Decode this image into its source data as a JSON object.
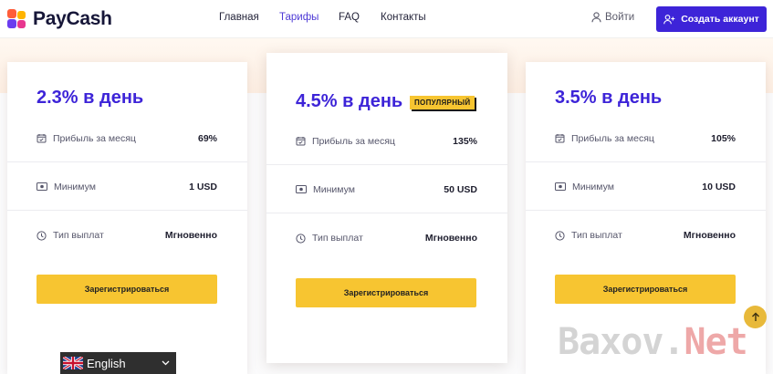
{
  "brand": {
    "name": "PayCash"
  },
  "nav": {
    "items": [
      {
        "label": "Главная",
        "active": false
      },
      {
        "label": "Тарифы",
        "active": true
      },
      {
        "label": "FAQ",
        "active": false
      },
      {
        "label": "Контакты",
        "active": false
      }
    ]
  },
  "header": {
    "login_label": "Войти",
    "signup_label": "Создать аккаунт"
  },
  "plans": [
    {
      "price": "2.3% в день",
      "badge": "",
      "rows": [
        {
          "icon": "calendar-check-icon",
          "label": "Прибыль за месяц",
          "value": "69%"
        },
        {
          "icon": "cash-icon",
          "label": "Минимум",
          "value": "1 USD"
        },
        {
          "icon": "clock-icon",
          "label": "Тип выплат",
          "value": "Мгновенно"
        }
      ],
      "button_label": "Зарегистрироваться"
    },
    {
      "price": "4.5% в день",
      "badge": "ПОПУЛЯРНЫЙ",
      "rows": [
        {
          "icon": "calendar-check-icon",
          "label": "Прибыль за месяц",
          "value": "135%"
        },
        {
          "icon": "cash-icon",
          "label": "Минимум",
          "value": "50 USD"
        },
        {
          "icon": "clock-icon",
          "label": "Тип выплат",
          "value": "Мгновенно"
        }
      ],
      "button_label": "Зарегистрироваться"
    },
    {
      "price": "3.5% в день",
      "badge": "",
      "rows": [
        {
          "icon": "calendar-check-icon",
          "label": "Прибыль за месяц",
          "value": "105%"
        },
        {
          "icon": "cash-icon",
          "label": "Минимум",
          "value": "10 USD"
        },
        {
          "icon": "clock-icon",
          "label": "Тип выплат",
          "value": "Мгновенно"
        }
      ],
      "button_label": "Зарегистрироваться"
    }
  ],
  "language_selector": {
    "flag_icon": "uk-flag-icon",
    "label": "English"
  },
  "watermark": {
    "text_main": "Baxov.",
    "text_accent": "Net"
  },
  "colors": {
    "accent": "#3d24d8",
    "highlight": "#f7c531",
    "nav_active": "#4f3bd6",
    "band": "#fdeee2"
  }
}
